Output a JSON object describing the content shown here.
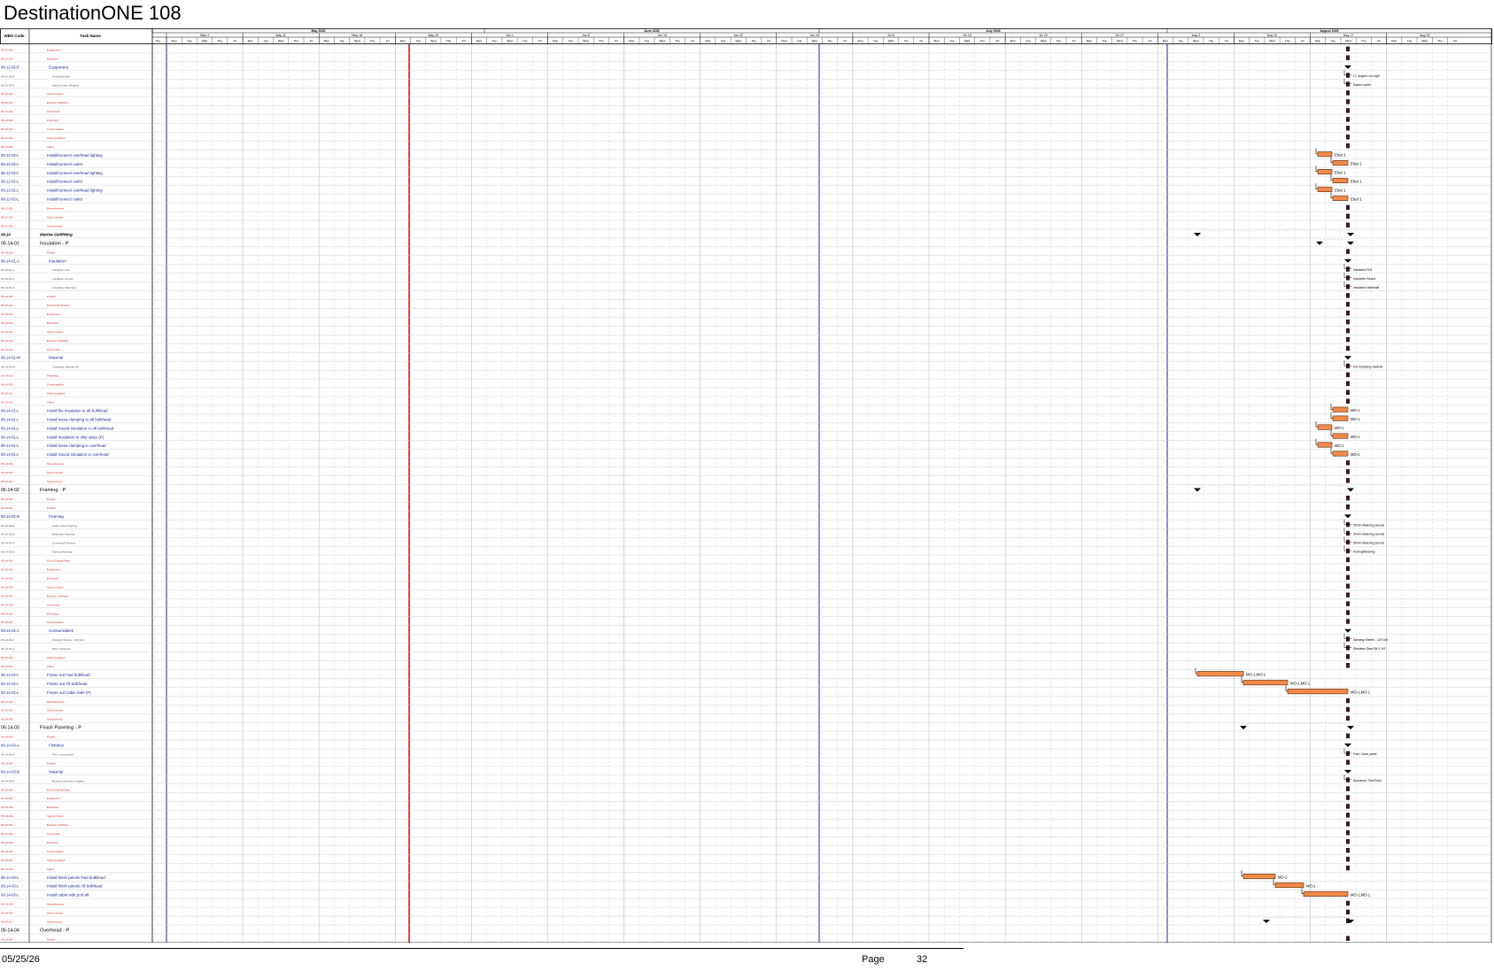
{
  "document": {
    "title": "DestinationONE 108",
    "footer_date": "05/25/26",
    "footer_page_label": "Page",
    "footer_page_number": "32"
  },
  "table_headers": {
    "wbs": "WBS Code",
    "task": "Task Name"
  },
  "timescale": {
    "months": [
      "May 2026",
      "June 2026",
      "July 2026",
      "August 2026"
    ],
    "weeks": [
      "May 4",
      "May 11",
      "May 18",
      "May 25",
      "Jun 1",
      "Jun 8",
      "Jun 15",
      "Jun 22",
      "Jun 29",
      "Jul 6",
      "Jul 13",
      "Jul 20",
      "Jul 27",
      "Aug 3",
      "Aug 10",
      "Aug 17",
      "Aug 24"
    ],
    "days": [
      "Thu",
      "Fri",
      "Mon",
      "Tue",
      "Wed",
      "Thu",
      "Fri",
      "Mon",
      "Tue",
      "Wed",
      "Thu",
      "Fri"
    ]
  },
  "colors": {
    "bar_fill": "#f08a4b",
    "bar_stroke": "#5a2a10",
    "summary": "#000000",
    "milestone": "#3b1a2a",
    "red_text": "#d8232a",
    "blue_text": "#1c2a8c",
    "status_line": "#cc1f1f",
    "blue_line": "#2b3aa8",
    "grid": "#9aa0a8"
  },
  "tasks": [
    {
      "wbs": "06-12-02-I",
      "name": "Equipment",
      "style": "red"
    },
    {
      "wbs": "06-12-02-I",
      "name": "Electrical",
      "style": "red"
    },
    {
      "wbs": "06-12-02-E",
      "name": "Equipment",
      "style": "sub"
    },
    {
      "wbs": "06-12-02-E",
      "name": "Overhead light",
      "style": "detail",
      "label": "LT, Angled, xxx light"
    },
    {
      "wbs": "06-12-02-E",
      "name": "Marine outlet (Duplex)",
      "style": "detail",
      "label": "Duplex outlet"
    },
    {
      "wbs": "06-12-02-I",
      "name": "Interior Doors",
      "style": "red"
    },
    {
      "wbs": "06-12-02-I",
      "name": "Exterior Outfitting",
      "style": "red"
    },
    {
      "wbs": "06-12-02-I",
      "name": "Chemicals",
      "style": "red"
    },
    {
      "wbs": "06-12-02-I",
      "name": "Plumbing",
      "style": "red"
    },
    {
      "wbs": "06-12-02-I",
      "name": "Consumables",
      "style": "red"
    },
    {
      "wbs": "06-12-02-I",
      "name": "Client supplied",
      "style": "red"
    },
    {
      "wbs": "06-12-02-I",
      "name": "Labor",
      "style": "red"
    },
    {
      "wbs": "06-12-02-L",
      "name": "Install/connect overhead lighting",
      "style": "task",
      "label": "Elect 1"
    },
    {
      "wbs": "06-12-02-L",
      "name": "Install/connect outlet",
      "style": "task",
      "label": "Elect 1"
    },
    {
      "wbs": "06-12-02-L",
      "name": "Install/connect overhead lighting",
      "style": "task",
      "label": "Elect 1"
    },
    {
      "wbs": "06-12-02-L",
      "name": "Install/connect outlet",
      "style": "task",
      "label": "Elect 1"
    },
    {
      "wbs": "06-12-02-L",
      "name": "Install/connect overhead lighting",
      "style": "task",
      "label": "Elect 1"
    },
    {
      "wbs": "06-12-02-L",
      "name": "Install/connect outlet",
      "style": "task",
      "label": "Elect 1"
    },
    {
      "wbs": "06-12-02-I",
      "name": "Miscellaneous",
      "style": "red"
    },
    {
      "wbs": "06-12-02-I",
      "name": "Sub-Contract",
      "style": "red"
    },
    {
      "wbs": "06-12-02-I",
      "name": "Outsourcing",
      "style": "red"
    },
    {
      "wbs": "06-14",
      "name": "Marine Outfitting",
      "style": "bold"
    },
    {
      "wbs": "06-14-01",
      "name": "Insulation - P",
      "style": "group"
    },
    {
      "wbs": "06-14-01-I",
      "name": "Panels",
      "style": "red"
    },
    {
      "wbs": "06-14-01-A",
      "name": "Insulation",
      "style": "sub"
    },
    {
      "wbs": "06-14-01-A",
      "name": "Insulation Fire",
      "style": "detail",
      "label": "Insulation Fire"
    },
    {
      "wbs": "06-14-01-A",
      "name": "Insulation Sound",
      "style": "detail",
      "label": "Insulation Sound"
    },
    {
      "wbs": "06-14-01-A",
      "name": "Insulation Materials",
      "style": "detail",
      "label": "Insulation Materials"
    },
    {
      "wbs": "06-14-01-I",
      "name": "Profiles",
      "style": "red"
    },
    {
      "wbs": "06-14-01-I",
      "name": "Floor/Ceiling/Glass",
      "style": "red"
    },
    {
      "wbs": "06-14-01-I",
      "name": "Equipment",
      "style": "red"
    },
    {
      "wbs": "06-14-01-I",
      "name": "Electrical",
      "style": "red"
    },
    {
      "wbs": "06-14-01-I",
      "name": "Interior Doors",
      "style": "red"
    },
    {
      "wbs": "06-14-01-I",
      "name": "Exterior Outfitting",
      "style": "red"
    },
    {
      "wbs": "06-14-01-I",
      "name": "Chemicals",
      "style": "red"
    },
    {
      "wbs": "06-14-01-M",
      "name": "Material",
      "style": "sub"
    },
    {
      "wbs": "06-14-01-M",
      "name": "Clamping material DS",
      "style": "detail",
      "label": "DS Clamping material"
    },
    {
      "wbs": "06-14-01-I",
      "name": "Plumbing",
      "style": "red"
    },
    {
      "wbs": "06-14-01-I",
      "name": "Consumables",
      "style": "red"
    },
    {
      "wbs": "06-14-01-I",
      "name": "Client supplied",
      "style": "red"
    },
    {
      "wbs": "06-14-01-I",
      "name": "Labor",
      "style": "red"
    },
    {
      "wbs": "06-14-01-L",
      "name": "Install fire insulation to aft bulkhead",
      "style": "task",
      "label": "MO-1"
    },
    {
      "wbs": "06-14-01-L",
      "name": "Install mesa clamping to aft bulkhead",
      "style": "task",
      "label": "MO-1"
    },
    {
      "wbs": "06-14-01-L",
      "name": "Install Sound insulation to aft bulkhead",
      "style": "task",
      "label": "MO-1"
    },
    {
      "wbs": "06-14-01-L",
      "name": "Install Insulation to ship sides (P)",
      "style": "task",
      "label": "MO-1"
    },
    {
      "wbs": "06-14-01-L",
      "name": "Install mesa clamping to overhead",
      "style": "task",
      "label": "MO-1"
    },
    {
      "wbs": "06-14-01-L",
      "name": "Install Sound insulation to overhead",
      "style": "task",
      "label": "MO-1"
    },
    {
      "wbs": "06-14-01-I",
      "name": "Miscellaneous",
      "style": "red"
    },
    {
      "wbs": "06-14-01-I",
      "name": "Sub-Contract",
      "style": "red"
    },
    {
      "wbs": "06-14-01-I",
      "name": "Outsourcing",
      "style": "red"
    },
    {
      "wbs": "06-14-02",
      "name": "Framing - P",
      "style": "group"
    },
    {
      "wbs": "06-14-02-I",
      "name": "Panels",
      "style": "red"
    },
    {
      "wbs": "06-14-02-I",
      "name": "Profiles",
      "style": "red"
    },
    {
      "wbs": "06-14-02-B",
      "name": "Framing",
      "style": "sub"
    },
    {
      "wbs": "06-14-02-B",
      "name": "Cabin sides Framing",
      "style": "detail",
      "label": "50mm Matering (wood)"
    },
    {
      "wbs": "06-14-02-B",
      "name": "Bulkhead Framing",
      "style": "detail",
      "label": "50mm Matering (wood)"
    },
    {
      "wbs": "06-14-02-B",
      "name": "Overhead Framing",
      "style": "detail",
      "label": "50mm Matering (wood)"
    },
    {
      "wbs": "06-14-02-B",
      "name": "Furring Blocking",
      "style": "detail",
      "label": "Furring/Blocking"
    },
    {
      "wbs": "06-14-02-I",
      "name": "Floor/Ceiling/Glass",
      "style": "red"
    },
    {
      "wbs": "06-14-02-I",
      "name": "Equipment",
      "style": "red"
    },
    {
      "wbs": "06-14-02-I",
      "name": "Electrical",
      "style": "red"
    },
    {
      "wbs": "06-14-02-I",
      "name": "Interior Doors",
      "style": "red"
    },
    {
      "wbs": "06-14-02-I",
      "name": "Exterior Outfitting",
      "style": "red"
    },
    {
      "wbs": "06-14-02-I",
      "name": "Chemicals",
      "style": "red"
    },
    {
      "wbs": "06-14-02-I",
      "name": "Plumbing",
      "style": "red"
    },
    {
      "wbs": "06-14-02-I",
      "name": "Consumables",
      "style": "red"
    },
    {
      "wbs": "06-14-02-J",
      "name": "Consumables",
      "style": "sub"
    },
    {
      "wbs": "06-14-02-J",
      "name": "Sanding Sheets - 120 Grit",
      "style": "detail",
      "label": "Sanding Sheets - 120 Grit"
    },
    {
      "wbs": "06-14-02-J",
      "name": "Marin Schenck",
      "style": "detail",
      "label": "Stainless Steel Bit 3 1/4\""
    },
    {
      "wbs": "06-14-02-I",
      "name": "Client supplied",
      "style": "red"
    },
    {
      "wbs": "06-14-02-I",
      "name": "Labor",
      "style": "red"
    },
    {
      "wbs": "06-14-02-L",
      "name": "Frame out Fwd bulkhead",
      "style": "task",
      "label": "MO-1,MO-1"
    },
    {
      "wbs": "06-14-02-L",
      "name": "Frame out Aft bulkhead",
      "style": "task",
      "label": "MO-1,MO-1"
    },
    {
      "wbs": "06-14-02-L",
      "name": "Frame out Cabin Side (P)",
      "style": "task",
      "label": "MO-1,MO-1"
    },
    {
      "wbs": "06-14-02-I",
      "name": "Miscellaneous",
      "style": "red"
    },
    {
      "wbs": "06-14-02-I",
      "name": "Sub-Contract",
      "style": "red"
    },
    {
      "wbs": "06-14-02-I",
      "name": "Outsourcing",
      "style": "red"
    },
    {
      "wbs": "06-14-03",
      "name": "Finish Paneling - P",
      "style": "group"
    },
    {
      "wbs": "06-14-03-I",
      "name": "Panels",
      "style": "red"
    },
    {
      "wbs": "06-14-03-A",
      "name": "Finishes",
      "style": "sub"
    },
    {
      "wbs": "06-14-03-A",
      "name": "Fwd / close panel",
      "style": "detail",
      "label": "Fwd / close panel"
    },
    {
      "wbs": "06-14-03-I",
      "name": "Profiles",
      "style": "red"
    },
    {
      "wbs": "06-14-03-B",
      "name": "Material",
      "style": "sub"
    },
    {
      "wbs": "06-14-03-B",
      "name": "Brushed aluminum edging",
      "style": "detail",
      "label": "Aluminum Trim/Trims"
    },
    {
      "wbs": "06-14-03-I",
      "name": "Floor/Ceiling/Glass",
      "style": "red"
    },
    {
      "wbs": "06-14-03-I",
      "name": "Equipment",
      "style": "red"
    },
    {
      "wbs": "06-14-03-I",
      "name": "Electrical",
      "style": "red"
    },
    {
      "wbs": "06-14-03-I",
      "name": "Interior Doors",
      "style": "red"
    },
    {
      "wbs": "06-14-03-I",
      "name": "Exterior Outfitting",
      "style": "red"
    },
    {
      "wbs": "06-14-03-I",
      "name": "Chemicals",
      "style": "red"
    },
    {
      "wbs": "06-14-03-I",
      "name": "Plumbing",
      "style": "red"
    },
    {
      "wbs": "06-14-03-I",
      "name": "Consumables",
      "style": "red"
    },
    {
      "wbs": "06-14-03-I",
      "name": "Client supplied",
      "style": "red"
    },
    {
      "wbs": "06-14-03-I",
      "name": "Labor",
      "style": "red"
    },
    {
      "wbs": "06-14-03-L",
      "name": "Install finish panels Fwd bulkhead",
      "style": "task",
      "label": "MO-1"
    },
    {
      "wbs": "06-14-03-L",
      "name": "Install finish panels Aft bulkhead",
      "style": "task",
      "label": "MO-1"
    },
    {
      "wbs": "06-14-03-L",
      "name": "Install cabin side port aft",
      "style": "task",
      "label": "MO-1,MO-1"
    },
    {
      "wbs": "06-14-03-I",
      "name": "Miscellaneous",
      "style": "red"
    },
    {
      "wbs": "06-14-03-I",
      "name": "Sub-Contract",
      "style": "red"
    },
    {
      "wbs": "06-14-03-I",
      "name": "Outsourcing",
      "style": "red"
    },
    {
      "wbs": "06-14-04",
      "name": "Overhead - P",
      "style": "group"
    },
    {
      "wbs": "06-14-04-I",
      "name": "Panels",
      "style": "red"
    }
  ]
}
